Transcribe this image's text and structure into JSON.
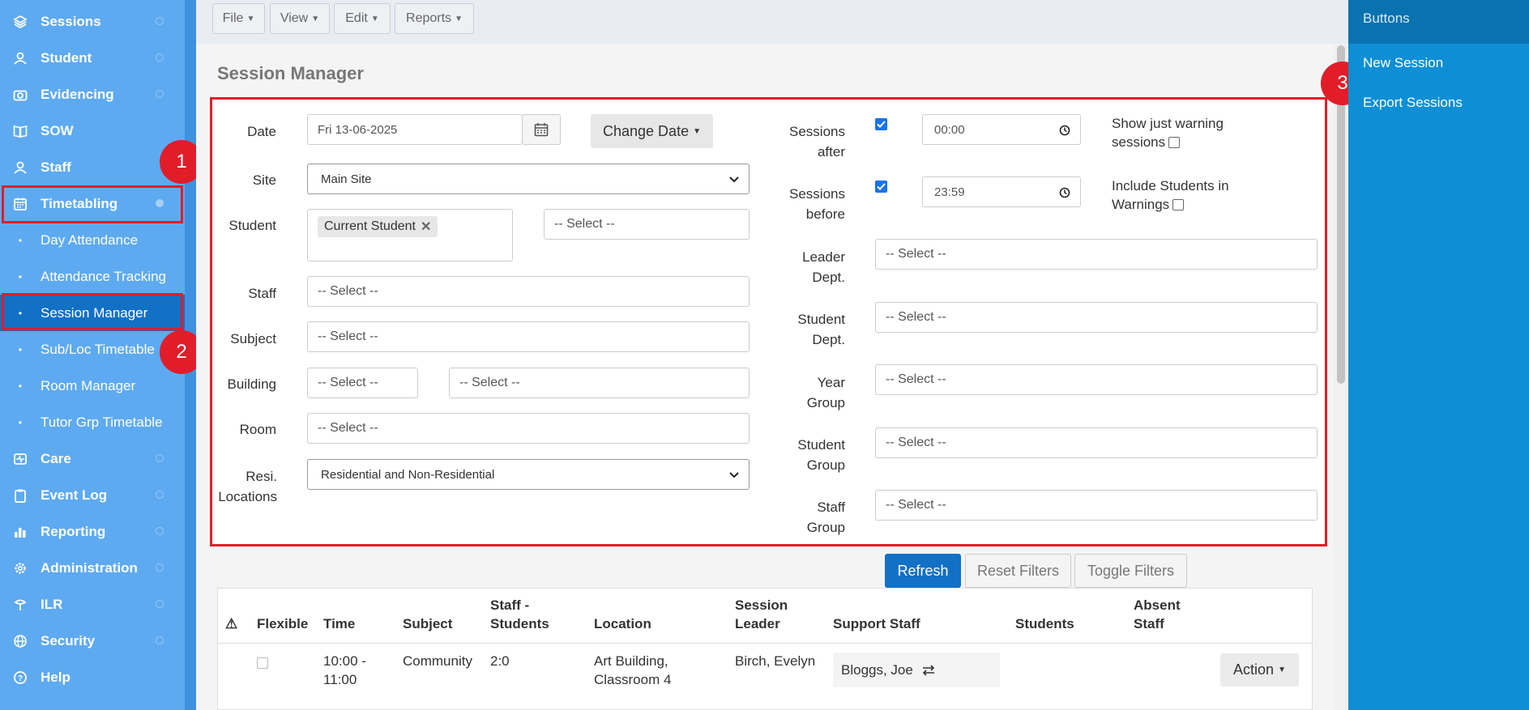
{
  "sidebar": {
    "items": [
      {
        "label": "Sessions",
        "icon": "layers-icon"
      },
      {
        "label": "Student",
        "icon": "students-icon"
      },
      {
        "label": "Evidencing",
        "icon": "camera-icon"
      },
      {
        "label": "SOW",
        "icon": "book-icon"
      },
      {
        "label": "Staff",
        "icon": "staff-icon"
      },
      {
        "label": "Timetabling",
        "icon": "calendar-icon"
      },
      {
        "label": "Care",
        "icon": "care-icon"
      },
      {
        "label": "Event Log",
        "icon": "clipboard-icon"
      },
      {
        "label": "Reporting",
        "icon": "chart-icon"
      },
      {
        "label": "Administration",
        "icon": "gear-icon"
      },
      {
        "label": "ILR",
        "icon": "ilr-icon"
      },
      {
        "label": "Security",
        "icon": "globe-icon"
      },
      {
        "label": "Help",
        "icon": "help-icon"
      }
    ],
    "subitems": [
      {
        "label": "Day Attendance"
      },
      {
        "label": "Attendance Tracking"
      },
      {
        "label": "Session Manager"
      },
      {
        "label": "Sub/Loc Timetable"
      },
      {
        "label": "Room Manager"
      },
      {
        "label": "Tutor Grp Timetable"
      }
    ]
  },
  "annotations": {
    "b1": "1",
    "b2": "2",
    "b3": "3"
  },
  "menubar": {
    "file": "File",
    "view": "View",
    "edit": "Edit",
    "reports": "Reports"
  },
  "page": {
    "title": "Session Manager"
  },
  "filters": {
    "date_label": "Date",
    "date_value": "Fri 13-06-2025",
    "change_date": "Change Date",
    "site_label": "Site",
    "site_value": "Main Site",
    "student_label": "Student",
    "student_tag": "Current Student",
    "student_select": "-- Select --",
    "staff_label": "Staff",
    "staff_select": "-- Select --",
    "subject_label": "Subject",
    "subject_select": "-- Select --",
    "building_label": "Building",
    "building_select1": "-- Select --",
    "building_select2": "-- Select --",
    "room_label": "Room",
    "room_select": "-- Select --",
    "resi_label_1": "Resi.",
    "resi_label_2": "Locations",
    "resi_value": "Residential and Non-Residential",
    "after_label_1": "Sessions",
    "after_label_2": "after",
    "after_checked": true,
    "after_time": "00:00",
    "before_label_1": "Sessions",
    "before_label_2": "before",
    "before_checked": true,
    "before_time": "23:59",
    "warn_label_1": "Show just warning",
    "warn_label_2": "sessions",
    "warn_checked": false,
    "incl_label_1": "Include Students in",
    "incl_label_2": "Warnings",
    "incl_checked": false,
    "leader_label_1": "Leader",
    "leader_label_2": "Dept.",
    "leader_select": "-- Select --",
    "sdept_label_1": "Student",
    "sdept_label_2": "Dept.",
    "sdept_select": "-- Select --",
    "year_label_1": "Year",
    "year_label_2": "Group",
    "year_select": "-- Select --",
    "sgroup_label_1": "Student",
    "sgroup_label_2": "Group",
    "sgroup_select": "-- Select --",
    "staffgrp_label_1": "Staff",
    "staffgrp_label_2": "Group",
    "staffgrp_select": "-- Select --"
  },
  "actions": {
    "refresh": "Refresh",
    "reset": "Reset Filters",
    "toggle": "Toggle Filters"
  },
  "table": {
    "headers": {
      "warning": "⚠",
      "flexible": "Flexible",
      "time": "Time",
      "subject": "Subject",
      "staff_students_1": "Staff -",
      "staff_students_2": "Students",
      "location": "Location",
      "leader_1": "Session",
      "leader_2": "Leader",
      "support": "Support Staff",
      "students": "Students",
      "absent_1": "Absent",
      "absent_2": "Staff"
    },
    "rows": [
      {
        "time_1": "10:00 -",
        "time_2": "11:00",
        "subject": "Community",
        "staff_students": "2:0",
        "location_1": "Art Building,",
        "location_2": "Classroom 4",
        "leader": "Birch, Evelyn",
        "support": "Bloggs, Joe",
        "action": "Action"
      }
    ]
  },
  "rightpanel": {
    "title": "Buttons",
    "new_session": "New Session",
    "export_sessions": "Export Sessions"
  },
  "colors": {
    "sidebar": "#5eaaf0",
    "active": "#1270c5",
    "annotation": "#e11d2a",
    "right_panel": "#0e8fd5",
    "refresh": "#1270c5"
  }
}
